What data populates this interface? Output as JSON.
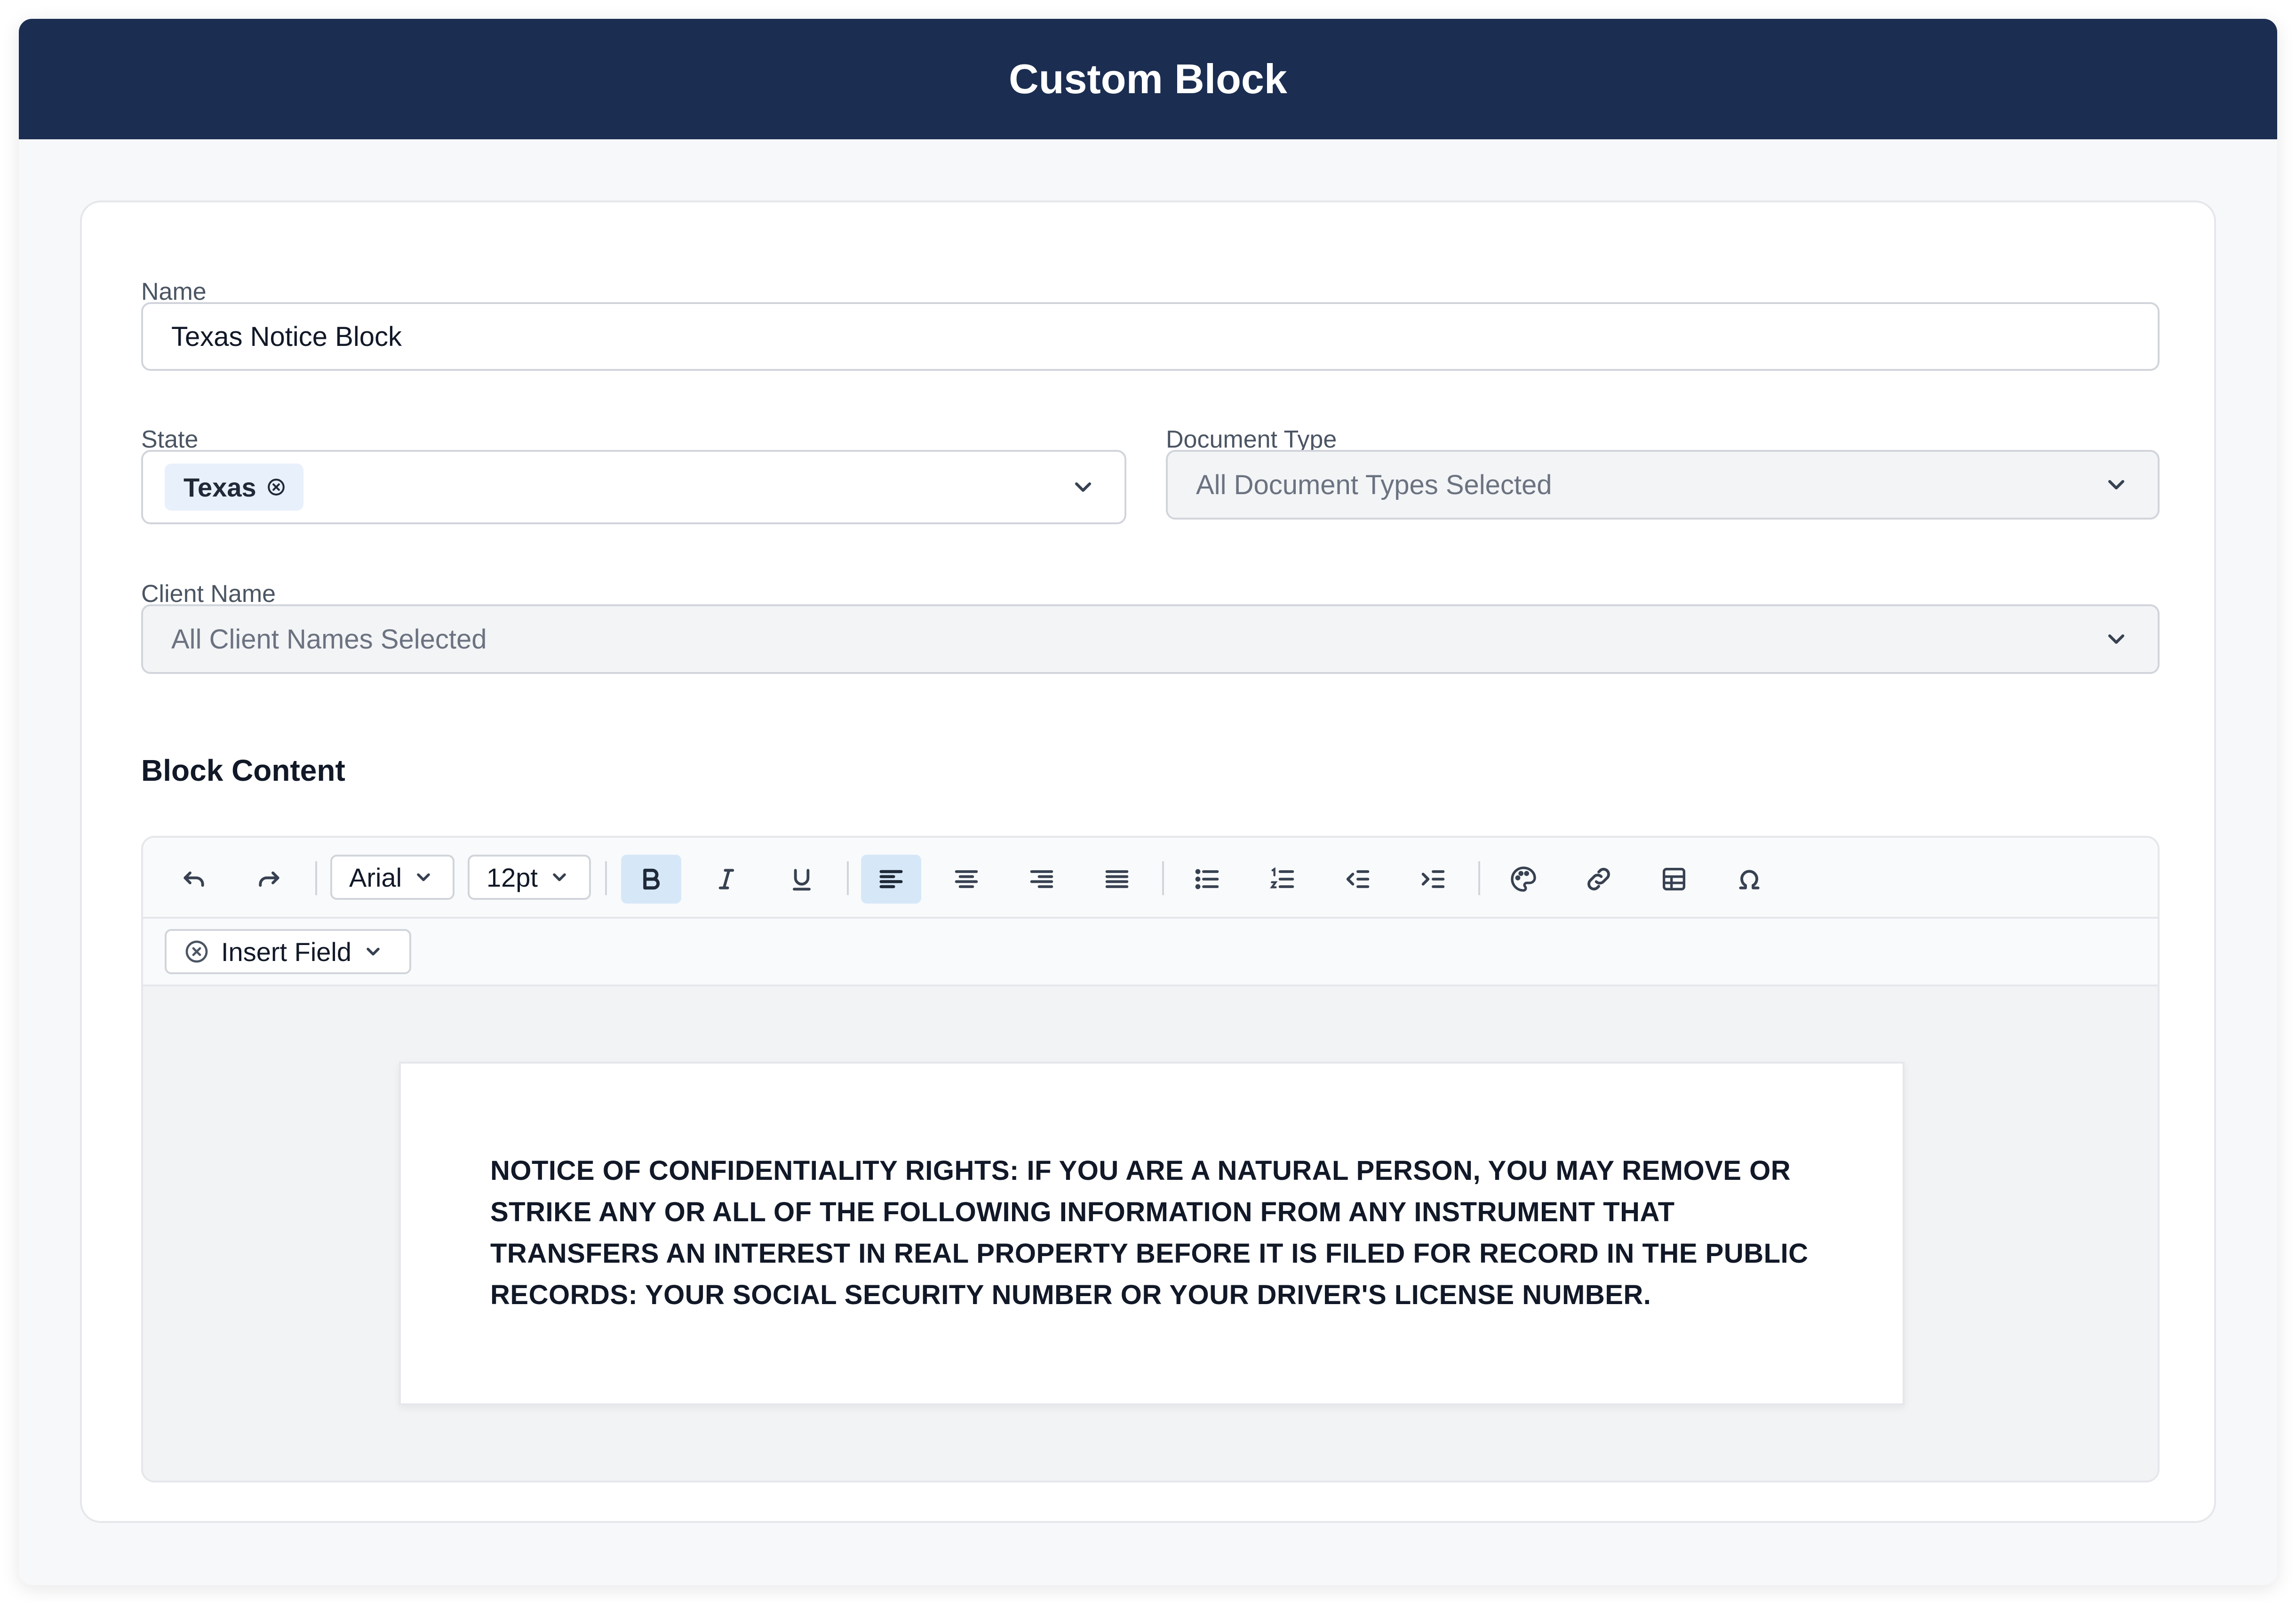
{
  "header": {
    "title": "Custom Block"
  },
  "form": {
    "name": {
      "label": "Name",
      "value": "Texas Notice Block"
    },
    "state": {
      "label": "State",
      "chip": "Texas"
    },
    "document_type": {
      "label": "Document Type",
      "value": "All Document Types Selected"
    },
    "client_name": {
      "label": "Client Name",
      "value": "All Client Names Selected"
    }
  },
  "editor": {
    "section_title": "Block Content",
    "toolbar": {
      "font_family": "Arial",
      "font_size": "12pt",
      "buttons": [
        "undo-icon",
        "redo-icon",
        "bold-icon",
        "italic-icon",
        "underline-icon",
        "align-left-icon",
        "align-center-icon",
        "align-right-icon",
        "align-justify-icon",
        "bullet-list-icon",
        "numbered-list-icon",
        "outdent-icon",
        "indent-icon",
        "palette-icon",
        "link-icon",
        "table-icon",
        "omega-icon"
      ],
      "active": [
        "bold",
        "align-left"
      ],
      "insert_field_label": "Insert Field"
    },
    "content": "NOTICE OF CONFIDENTIALITY RIGHTS: IF YOU ARE A NATURAL PERSON, YOU MAY REMOVE OR STRIKE ANY OR ALL OF THE FOLLOWING INFORMATION FROM ANY INSTRUMENT THAT TRANSFERS AN INTEREST IN REAL PROPERTY BEFORE IT IS FILED FOR RECORD IN THE PUBLIC RECORDS: YOUR SOCIAL SECURITY NUMBER OR YOUR DRIVER'S LICENSE NUMBER."
  },
  "colors": {
    "header_bg": "#1b2d51",
    "active_button_bg": "#d6e8f8",
    "chip_bg": "#e8f0fb"
  }
}
